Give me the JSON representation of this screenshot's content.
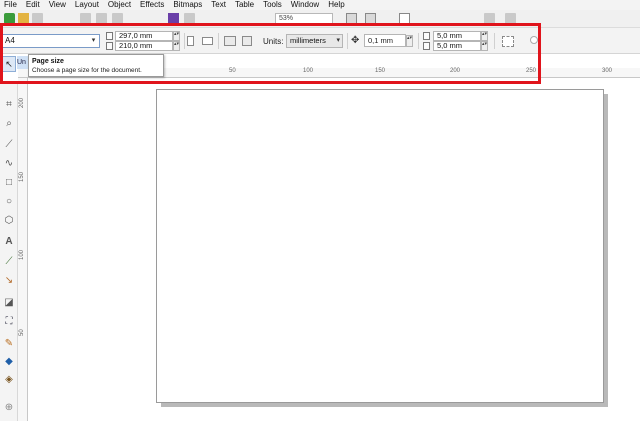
{
  "menu": [
    "File",
    "Edit",
    "View",
    "Layout",
    "Object",
    "Effects",
    "Bitmaps",
    "Text",
    "Table",
    "Tools",
    "Window",
    "Help"
  ],
  "toolbar": {
    "zoom_level": "53%"
  },
  "property_bar": {
    "page_size": "A4",
    "width": "297,0 mm",
    "height": "210,0 mm",
    "units_label": "Units:",
    "units_value": "millimeters",
    "nudge": "0,1 mm",
    "duplicate_x": "5,0 mm",
    "duplicate_y": "5,0 mm"
  },
  "tooltip": {
    "title": "Page size",
    "description": "Choose a page size for the document."
  },
  "doc_tab_label": "Un",
  "ruler": {
    "horizontal": [
      "50",
      "100",
      "150",
      "200",
      "250",
      "300"
    ],
    "vertical": [
      "200",
      "150",
      "100",
      "50"
    ]
  },
  "accent": "#e0141c"
}
